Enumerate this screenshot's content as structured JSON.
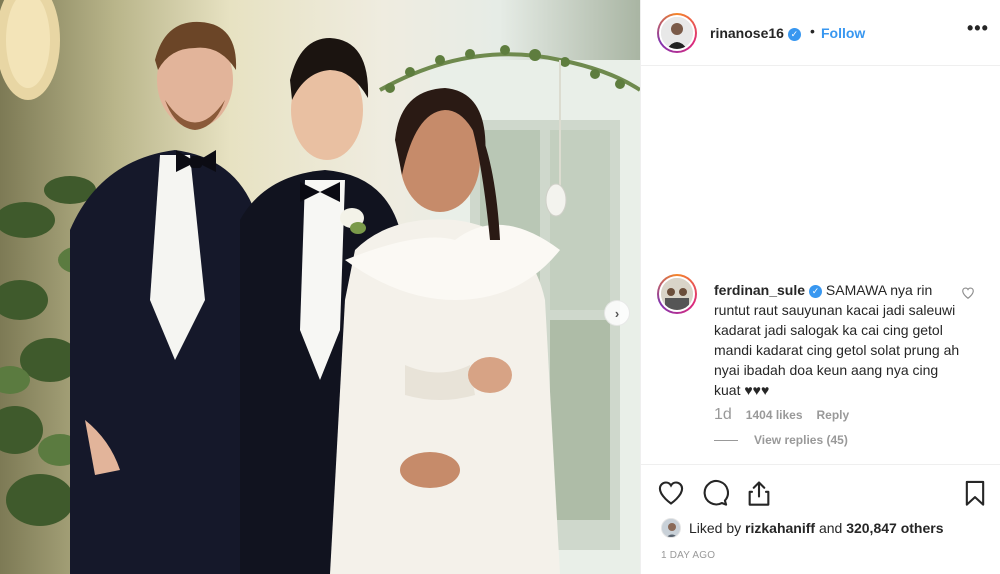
{
  "post": {
    "username": "rinanose16",
    "dot": "•",
    "follow_label": "Follow",
    "more_label": "•••",
    "carousel_next": "›"
  },
  "comment": {
    "username": "ferdinan_sule",
    "text": "SAMAWA nya rin runtut raut sauyunan kacai jadi saleuwi kadarat jadi salogak ka cai cing getol mandi kadarat cing getol solat prung ah nyai ibadah doa keun aang nya cing kuat ♥♥♥",
    "age": "1d",
    "likes": "1404 likes",
    "reply_label": "Reply",
    "view_replies": "View replies (45)"
  },
  "likes": {
    "prefix": "Liked by ",
    "user": "rizkahaniff",
    "middle": " and ",
    "count": "320,847 others"
  },
  "timestamp": "1 DAY AGO",
  "icons": {
    "like": "heart-icon",
    "comment": "comment-icon",
    "share": "share-icon",
    "save": "bookmark-icon",
    "verified": "verified-badge-icon"
  },
  "colors": {
    "link": "#3897f0",
    "text": "#262626",
    "muted": "#999999"
  }
}
